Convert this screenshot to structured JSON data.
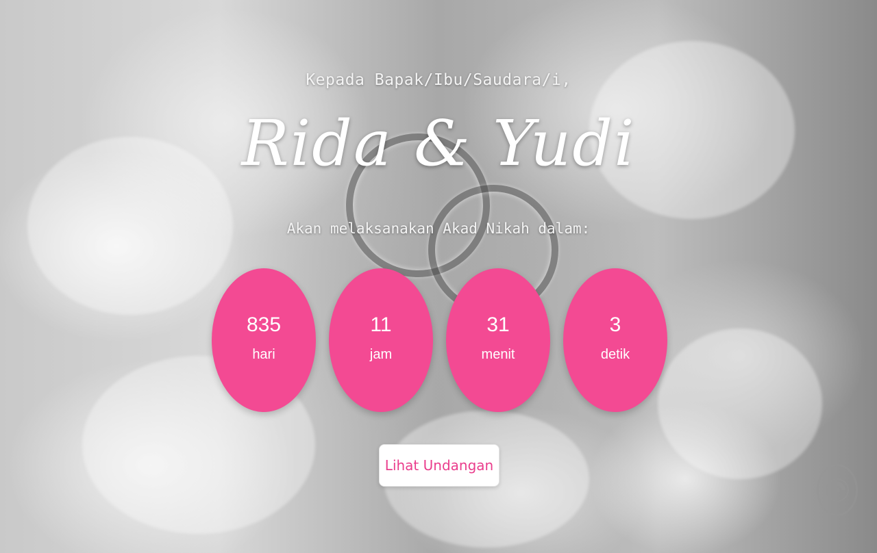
{
  "invitation": {
    "greeting": "Kepada Bapak/Ibu/Saudara/i,",
    "couple_names": "Rida & Yudi",
    "subtitle": "Akan melaksanakan Akad Nikah dalam:"
  },
  "countdown": [
    {
      "value": "835",
      "unit": "hari"
    },
    {
      "value": "11",
      "unit": "jam"
    },
    {
      "value": "31",
      "unit": "menit"
    },
    {
      "value": "3",
      "unit": "detik"
    }
  ],
  "cta": {
    "label": "Lihat Undangan"
  },
  "colors": {
    "accent": "#f34a93",
    "button_text": "#ea3d8c",
    "button_bg": "#ffffff"
  },
  "icons": {
    "music_toggle": "music-disc-icon"
  }
}
